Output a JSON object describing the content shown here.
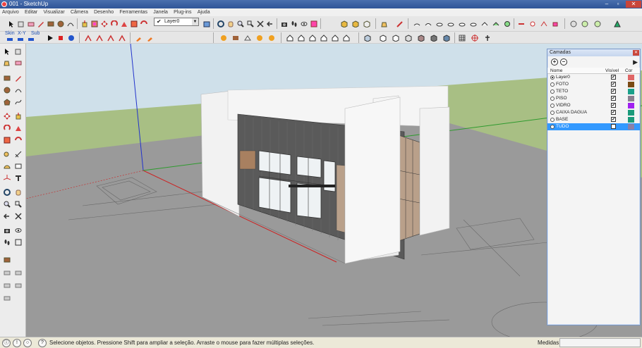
{
  "window": {
    "title": "001 - SketchUp"
  },
  "menu": [
    "Arquivo",
    "Editar",
    "Visualizar",
    "Câmera",
    "Desenho",
    "Ferramentas",
    "Janela",
    "Plug-ins",
    "Ajuda"
  ],
  "toolbar": {
    "layer_current": "Layer0",
    "skin_label": "Skin",
    "xyz_label": "X-Y",
    "sub_label": "Sub"
  },
  "layers_panel": {
    "title": "Camadas",
    "col_name": "Nome",
    "col_visible": "Visível",
    "col_color": "Cor",
    "layers": [
      {
        "name": "Layer0",
        "active": true,
        "visible": true,
        "color": "#e06666"
      },
      {
        "name": "FOTO",
        "active": false,
        "visible": true,
        "color": "#7a4a14"
      },
      {
        "name": "TETO",
        "active": false,
        "visible": true,
        "color": "#1aa08a"
      },
      {
        "name": "PISO",
        "active": false,
        "visible": true,
        "color": "#8a7f8f"
      },
      {
        "name": "VIDRO",
        "active": false,
        "visible": true,
        "color": "#a020f0"
      },
      {
        "name": "CAIXA DAGUA",
        "active": false,
        "visible": true,
        "color": "#1a9a7a"
      },
      {
        "name": "BASE",
        "active": false,
        "visible": true,
        "color": "#1a9a7a"
      },
      {
        "name": "TUDO",
        "active": false,
        "visible": false,
        "color": "#8a80a8",
        "selected": true
      }
    ]
  },
  "status": {
    "message": "Selecione objetos. Pressione Shift para ampliar a seleção. Arraste o mouse para fazer múltiplas seleções.",
    "measure_label": "Medidas",
    "measure_value": ""
  },
  "colors": {
    "sky": "#cfe0ea",
    "ground": "#a8bf84",
    "shadow_plane": "#9a9a9a"
  }
}
